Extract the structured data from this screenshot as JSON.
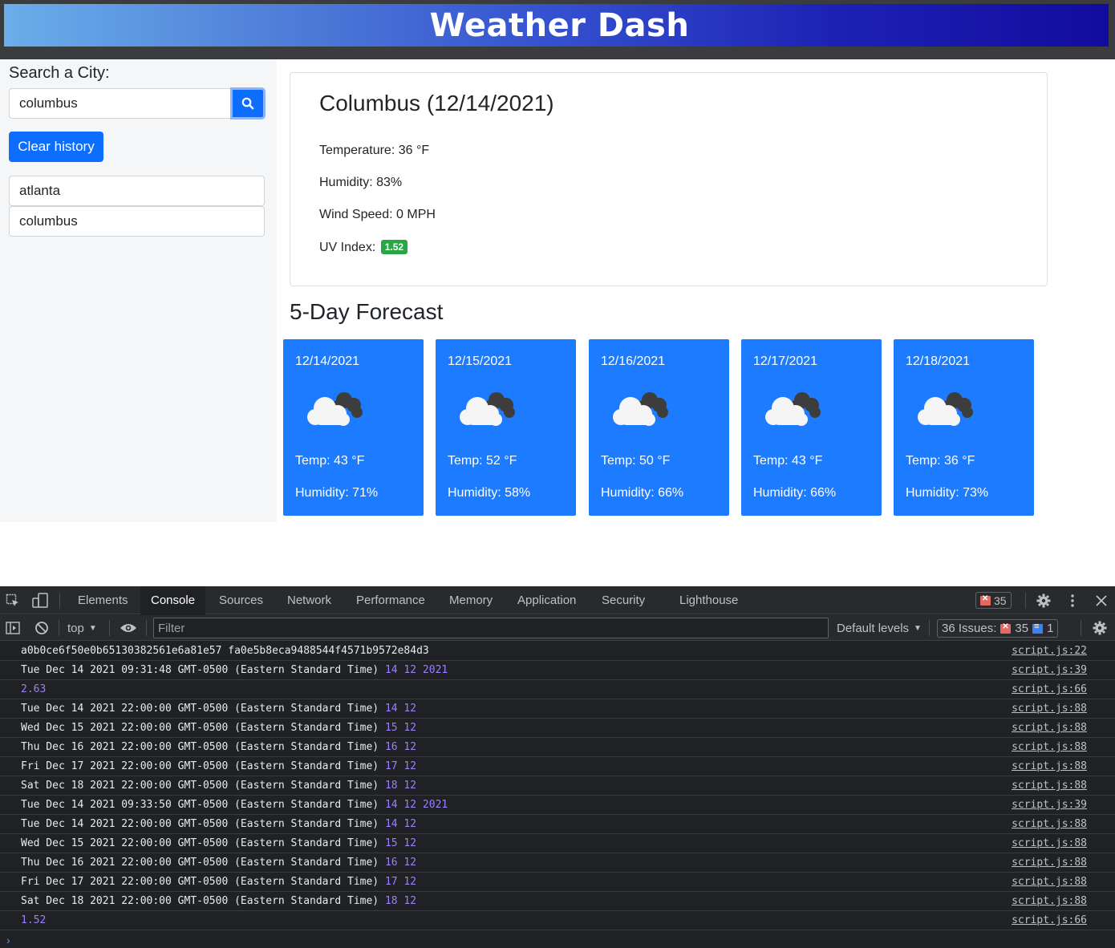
{
  "app": {
    "title": "Weather Dash"
  },
  "sidebar": {
    "search_label": "Search a City:",
    "search_value": "columbus",
    "clear_label": "Clear history",
    "history": [
      "atlanta",
      "columbus"
    ]
  },
  "current": {
    "title": "Columbus (12/14/2021)",
    "temperature": "Temperature: 36 °F",
    "humidity": "Humidity: 83%",
    "wind": "Wind Speed: 0 MPH",
    "uv_label": "UV Index:",
    "uv_value": "1.52",
    "uv_color": "#28a745"
  },
  "forecast": {
    "title": "5-Day Forecast",
    "days": [
      {
        "date": "12/14/2021",
        "icon": "cloudy-icon",
        "temp": "Temp: 43 °F",
        "humidity": "Humidity: 71%"
      },
      {
        "date": "12/15/2021",
        "icon": "cloudy-icon",
        "temp": "Temp: 52 °F",
        "humidity": "Humidity: 58%"
      },
      {
        "date": "12/16/2021",
        "icon": "cloudy-icon",
        "temp": "Temp: 50 °F",
        "humidity": "Humidity: 66%"
      },
      {
        "date": "12/17/2021",
        "icon": "cloudy-icon",
        "temp": "Temp: 43 °F",
        "humidity": "Humidity: 66%"
      },
      {
        "date": "12/18/2021",
        "icon": "cloudy-icon",
        "temp": "Temp: 36 °F",
        "humidity": "Humidity: 73%"
      }
    ]
  },
  "devtools": {
    "tabs": [
      "Elements",
      "Console",
      "Sources",
      "Network",
      "Performance",
      "Memory",
      "Application",
      "Security",
      "Lighthouse"
    ],
    "active_tab": "Console",
    "error_count": "35",
    "context": "top",
    "filter_placeholder": "Filter",
    "levels": "Default levels",
    "issues_label": "36 Issues:",
    "issues_errors": "35",
    "issues_info": "1",
    "logs": [
      {
        "text": "a0b0ce6f50e0b65130382561e6a81e57 fa0e5b8eca9488544f4571b9572e84d3",
        "nums": "",
        "src": "script.js:22"
      },
      {
        "text": "Tue Dec 14 2021 09:31:48 GMT-0500 (Eastern Standard Time) ",
        "nums": "14 12 2021",
        "src": "script.js:39"
      },
      {
        "text": "",
        "nums": "2.63",
        "src": "script.js:66"
      },
      {
        "text": "Tue Dec 14 2021 22:00:00 GMT-0500 (Eastern Standard Time) ",
        "nums": "14 12",
        "src": "script.js:88"
      },
      {
        "text": "Wed Dec 15 2021 22:00:00 GMT-0500 (Eastern Standard Time) ",
        "nums": "15 12",
        "src": "script.js:88"
      },
      {
        "text": "Thu Dec 16 2021 22:00:00 GMT-0500 (Eastern Standard Time) ",
        "nums": "16 12",
        "src": "script.js:88"
      },
      {
        "text": "Fri Dec 17 2021 22:00:00 GMT-0500 (Eastern Standard Time) ",
        "nums": "17 12",
        "src": "script.js:88"
      },
      {
        "text": "Sat Dec 18 2021 22:00:00 GMT-0500 (Eastern Standard Time) ",
        "nums": "18 12",
        "src": "script.js:88"
      },
      {
        "text": "Tue Dec 14 2021 09:33:50 GMT-0500 (Eastern Standard Time) ",
        "nums": "14 12 2021",
        "src": "script.js:39"
      },
      {
        "text": "Tue Dec 14 2021 22:00:00 GMT-0500 (Eastern Standard Time) ",
        "nums": "14 12",
        "src": "script.js:88"
      },
      {
        "text": "Wed Dec 15 2021 22:00:00 GMT-0500 (Eastern Standard Time) ",
        "nums": "15 12",
        "src": "script.js:88"
      },
      {
        "text": "Thu Dec 16 2021 22:00:00 GMT-0500 (Eastern Standard Time) ",
        "nums": "16 12",
        "src": "script.js:88"
      },
      {
        "text": "Fri Dec 17 2021 22:00:00 GMT-0500 (Eastern Standard Time) ",
        "nums": "17 12",
        "src": "script.js:88"
      },
      {
        "text": "Sat Dec 18 2021 22:00:00 GMT-0500 (Eastern Standard Time) ",
        "nums": "18 12",
        "src": "script.js:88"
      },
      {
        "text": "",
        "nums": "1.52",
        "src": "script.js:66"
      }
    ]
  },
  "colors": {
    "primary": "#0d6efd",
    "card": "#1c7bff",
    "console_number": "#9980ff"
  }
}
